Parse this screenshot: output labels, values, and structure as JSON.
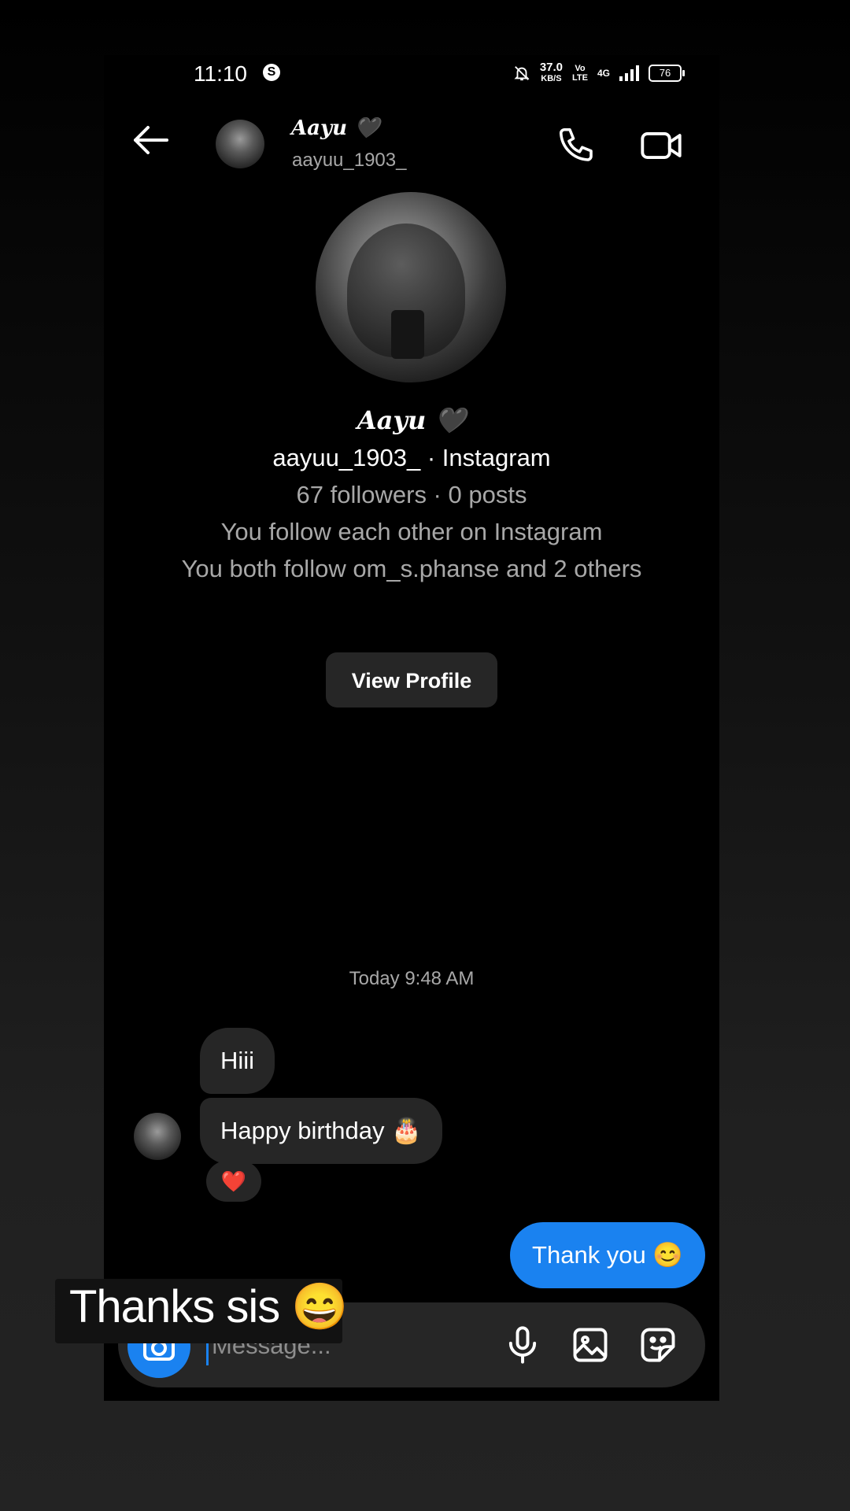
{
  "status_bar": {
    "time": "11:10",
    "app_badge": "S",
    "net_speed": "37.0",
    "net_unit": "KB/S",
    "volte_top": "Vo",
    "volte_bottom": "LTE",
    "network": "4G",
    "battery": "76"
  },
  "header": {
    "name": "Aayu 🖤",
    "username": "aayuu_1903_"
  },
  "profile": {
    "name": "Aayu 🖤",
    "username_line": "aayuu_1903_ · Instagram",
    "stats": "67 followers · 0 posts",
    "mutual_follow": "You follow each other on Instagram",
    "mutual_friends": "You both follow om_s.phanse and 2 others",
    "view_profile_label": "View Profile"
  },
  "conversation": {
    "timestamp": "Today 9:48 AM",
    "received": [
      {
        "text": "Hiii"
      },
      {
        "text": "Happy birthday 🎂"
      }
    ],
    "reaction": "❤️",
    "sent": [
      {
        "text": "Thank you 😊"
      }
    ]
  },
  "composer": {
    "placeholder": "Message..."
  },
  "overlay": {
    "text": "Thanks sis 😄"
  },
  "colors": {
    "accent": "#1a82f0",
    "bubble_in": "#262626",
    "muted_text": "#a8a8a8"
  }
}
